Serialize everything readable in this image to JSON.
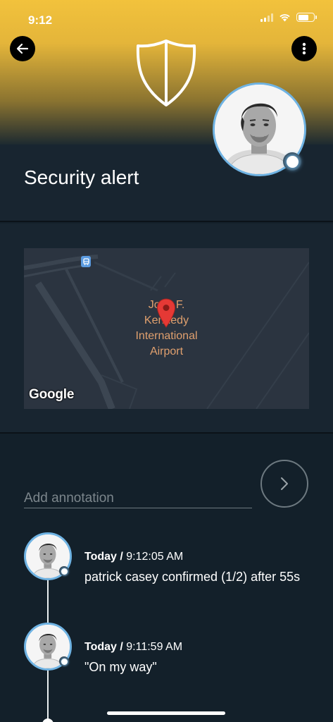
{
  "status_bar": {
    "time": "9:12"
  },
  "header": {
    "back_icon": "arrow-left-icon",
    "more_icon": "more-vertical-icon",
    "shield_icon": "shield-icon",
    "accent_color": "#f2c23c",
    "avatar_ring_color": "#6fb3e3"
  },
  "alert": {
    "title": "Security alert"
  },
  "map": {
    "place_label_line1": "John F.",
    "place_label_line2": "Kennedy",
    "place_label_line3": "International",
    "place_label_line4": "Airport",
    "logo": "Google",
    "pin_icon": "map-pin-icon",
    "transit_icon": "train-icon"
  },
  "annotation": {
    "placeholder": "Add annotation",
    "send_icon": "chevron-right-icon"
  },
  "timeline": [
    {
      "day": "Today",
      "separator": " / ",
      "time": "9:12:05 AM",
      "text": "patrick casey confirmed (1/2) after 55s"
    },
    {
      "day": "Today",
      "separator": " / ",
      "time": "9:11:59 AM",
      "text": "\"On my way\""
    }
  ]
}
